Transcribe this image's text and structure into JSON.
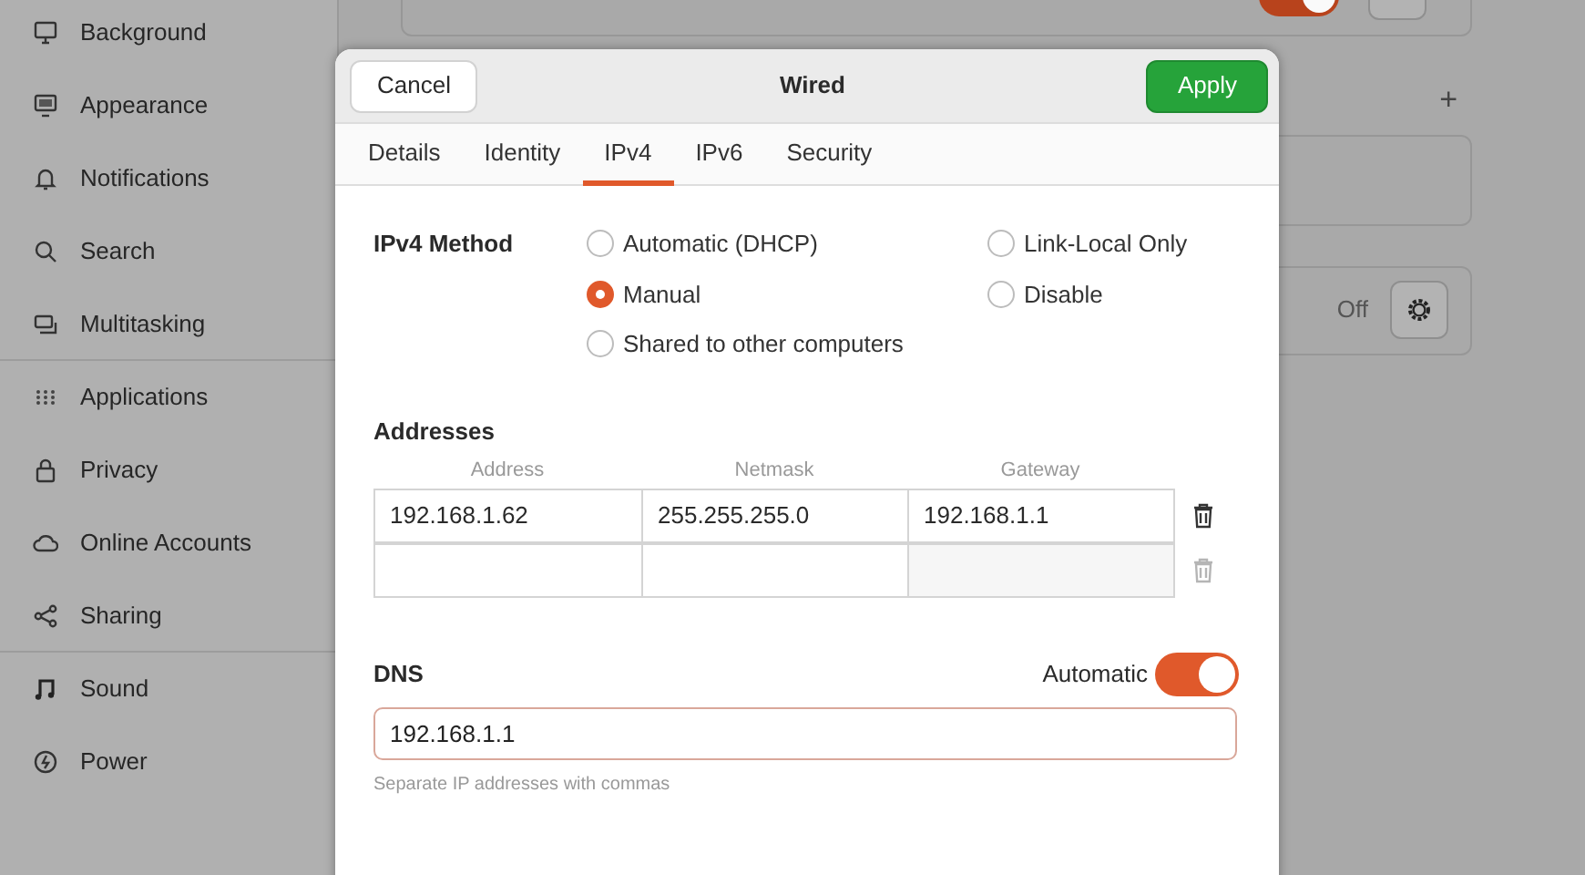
{
  "sidebar": {
    "items": [
      {
        "label": "Background"
      },
      {
        "label": "Appearance"
      },
      {
        "label": "Notifications"
      },
      {
        "label": "Search"
      },
      {
        "label": "Multitasking",
        "divider_after": true
      },
      {
        "label": "Applications"
      },
      {
        "label": "Privacy"
      },
      {
        "label": "Online Accounts"
      },
      {
        "label": "Sharing",
        "divider_after": true
      },
      {
        "label": "Sound"
      },
      {
        "label": "Power"
      }
    ]
  },
  "background_panel": {
    "top_toggle_on": true,
    "add_label": "+",
    "proxy_state": "Off"
  },
  "dialog": {
    "title": "Wired",
    "cancel": "Cancel",
    "apply": "Apply",
    "tabs": [
      {
        "label": "Details",
        "selected": false
      },
      {
        "label": "Identity",
        "selected": false
      },
      {
        "label": "IPv4",
        "selected": true
      },
      {
        "label": "IPv6",
        "selected": false
      },
      {
        "label": "Security",
        "selected": false
      }
    ],
    "method": {
      "label": "IPv4 Method",
      "options": [
        {
          "label": "Automatic (DHCP)",
          "selected": false
        },
        {
          "label": "Link-Local Only",
          "selected": false
        },
        {
          "label": "Manual",
          "selected": true
        },
        {
          "label": "Disable",
          "selected": false
        },
        {
          "label": "Shared to other computers",
          "selected": false
        }
      ]
    },
    "addresses": {
      "heading": "Addresses",
      "columns": [
        "Address",
        "Netmask",
        "Gateway"
      ],
      "rows": [
        {
          "address": "192.168.1.62",
          "netmask": "255.255.255.0",
          "gateway": "192.168.1.1"
        }
      ]
    },
    "dns": {
      "heading": "DNS",
      "automatic_label": "Automatic",
      "automatic_on": true,
      "value": "192.168.1.1",
      "hint": "Separate IP addresses with commas"
    }
  }
}
